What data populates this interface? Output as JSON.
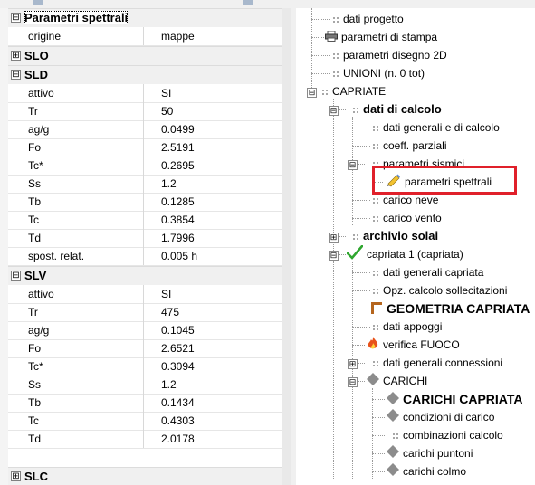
{
  "property_grid": {
    "sections": [
      {
        "id": "spettrali",
        "title": "Parametri spettrali",
        "expanded": true,
        "toggle": "⊟",
        "rows": [
          {
            "key": "origine",
            "value": "mappe"
          }
        ]
      },
      {
        "id": "slo",
        "title": "SLO",
        "expanded": false,
        "toggle": "⊞",
        "rows": []
      },
      {
        "id": "sld",
        "title": "SLD",
        "expanded": true,
        "toggle": "⊟",
        "rows": [
          {
            "key": "attivo",
            "value": "SI"
          },
          {
            "key": "Tr",
            "value": "50"
          },
          {
            "key": "ag/g",
            "value": "0.0499"
          },
          {
            "key": "Fo",
            "value": "2.5191"
          },
          {
            "key": "Tc*",
            "value": "0.2695"
          },
          {
            "key": "Ss",
            "value": "1.2"
          },
          {
            "key": "Tb",
            "value": "0.1285"
          },
          {
            "key": "Tc",
            "value": "0.3854"
          },
          {
            "key": "Td",
            "value": "1.7996"
          },
          {
            "key": "spost. relat.",
            "value": "0.005 h"
          }
        ]
      },
      {
        "id": "slv",
        "title": "SLV",
        "expanded": true,
        "toggle": "⊟",
        "rows": [
          {
            "key": "attivo",
            "value": "SI"
          },
          {
            "key": "Tr",
            "value": "475"
          },
          {
            "key": "ag/g",
            "value": "0.1045"
          },
          {
            "key": "Fo",
            "value": "2.6521"
          },
          {
            "key": "Tc*",
            "value": "0.3094"
          },
          {
            "key": "Ss",
            "value": "1.2"
          },
          {
            "key": "Tb",
            "value": "0.1434"
          },
          {
            "key": "Tc",
            "value": "0.4303"
          },
          {
            "key": "Td",
            "value": "2.0178"
          }
        ]
      },
      {
        "id": "slc",
        "title": "SLC",
        "expanded": false,
        "toggle": "⊞",
        "rows": []
      }
    ]
  },
  "tree": {
    "items": [
      {
        "label": "dati progetto",
        "icon": "grid-icon",
        "style": "normal"
      },
      {
        "label": "parametri di stampa",
        "icon": "printer-icon",
        "style": "normal"
      },
      {
        "label": "parametri disegno 2D",
        "icon": "grid-icon",
        "style": "normal"
      },
      {
        "label": "UNIONI (n. 0 tot)",
        "icon": "grid-icon",
        "style": "normal"
      },
      {
        "label": "CAPRIATE",
        "icon": "grid-icon",
        "style": "normal",
        "toggle": "⊟"
      },
      {
        "label": "dati di calcolo",
        "icon": "grid-icon",
        "style": "bold",
        "toggle": "⊟"
      },
      {
        "label": "dati generali e di calcolo",
        "icon": "grid-icon",
        "style": "normal"
      },
      {
        "label": "coeff. parziali",
        "icon": "grid-icon",
        "style": "normal"
      },
      {
        "label": "parametri sismici",
        "icon": "grid-icon",
        "style": "normal",
        "toggle": "⊟"
      },
      {
        "label": "parametri spettrali",
        "icon": "pencil-icon",
        "style": "normal",
        "highlighted": true
      },
      {
        "label": "carico neve",
        "icon": "grid-icon",
        "style": "normal"
      },
      {
        "label": "carico vento",
        "icon": "grid-icon",
        "style": "normal"
      },
      {
        "label": "archivio solai",
        "icon": "grid-icon",
        "style": "bold",
        "toggle": "⊞"
      },
      {
        "label": "capriata 1 (capriata)",
        "icon": "checkmark-icon",
        "style": "normal",
        "toggle": "⊟"
      },
      {
        "label": "dati generali capriata",
        "icon": "grid-icon",
        "style": "normal"
      },
      {
        "label": "Opz. calcolo sollecitazioni",
        "icon": "grid-icon",
        "style": "normal"
      },
      {
        "label": "GEOMETRIA CAPRIATA",
        "icon": "truss-icon",
        "style": "big"
      },
      {
        "label": "dati appoggi",
        "icon": "grid-icon",
        "style": "normal"
      },
      {
        "label": "verifica FUOCO",
        "icon": "fire-icon",
        "style": "normal"
      },
      {
        "label": "dati generali connessioni",
        "icon": "grid-icon",
        "style": "normal",
        "toggle": "⊞"
      },
      {
        "label": "CARICHI",
        "icon": "diamond-icon",
        "style": "normal",
        "toggle": "⊟"
      },
      {
        "label": "CARICHI CAPRIATA",
        "icon": "diamond-icon",
        "style": "big"
      },
      {
        "label": "condizioni di carico",
        "icon": "diamond-icon",
        "style": "normal"
      },
      {
        "label": "combinazioni calcolo",
        "icon": "grid-icon",
        "style": "normal"
      },
      {
        "label": "carichi puntoni",
        "icon": "diamond-icon",
        "style": "normal"
      },
      {
        "label": "carichi colmo",
        "icon": "diamond-icon",
        "style": "normal"
      }
    ]
  },
  "colors": {
    "highlight_box": "#e0202a",
    "check": "#2fa62f",
    "fire": "#e8521a"
  }
}
